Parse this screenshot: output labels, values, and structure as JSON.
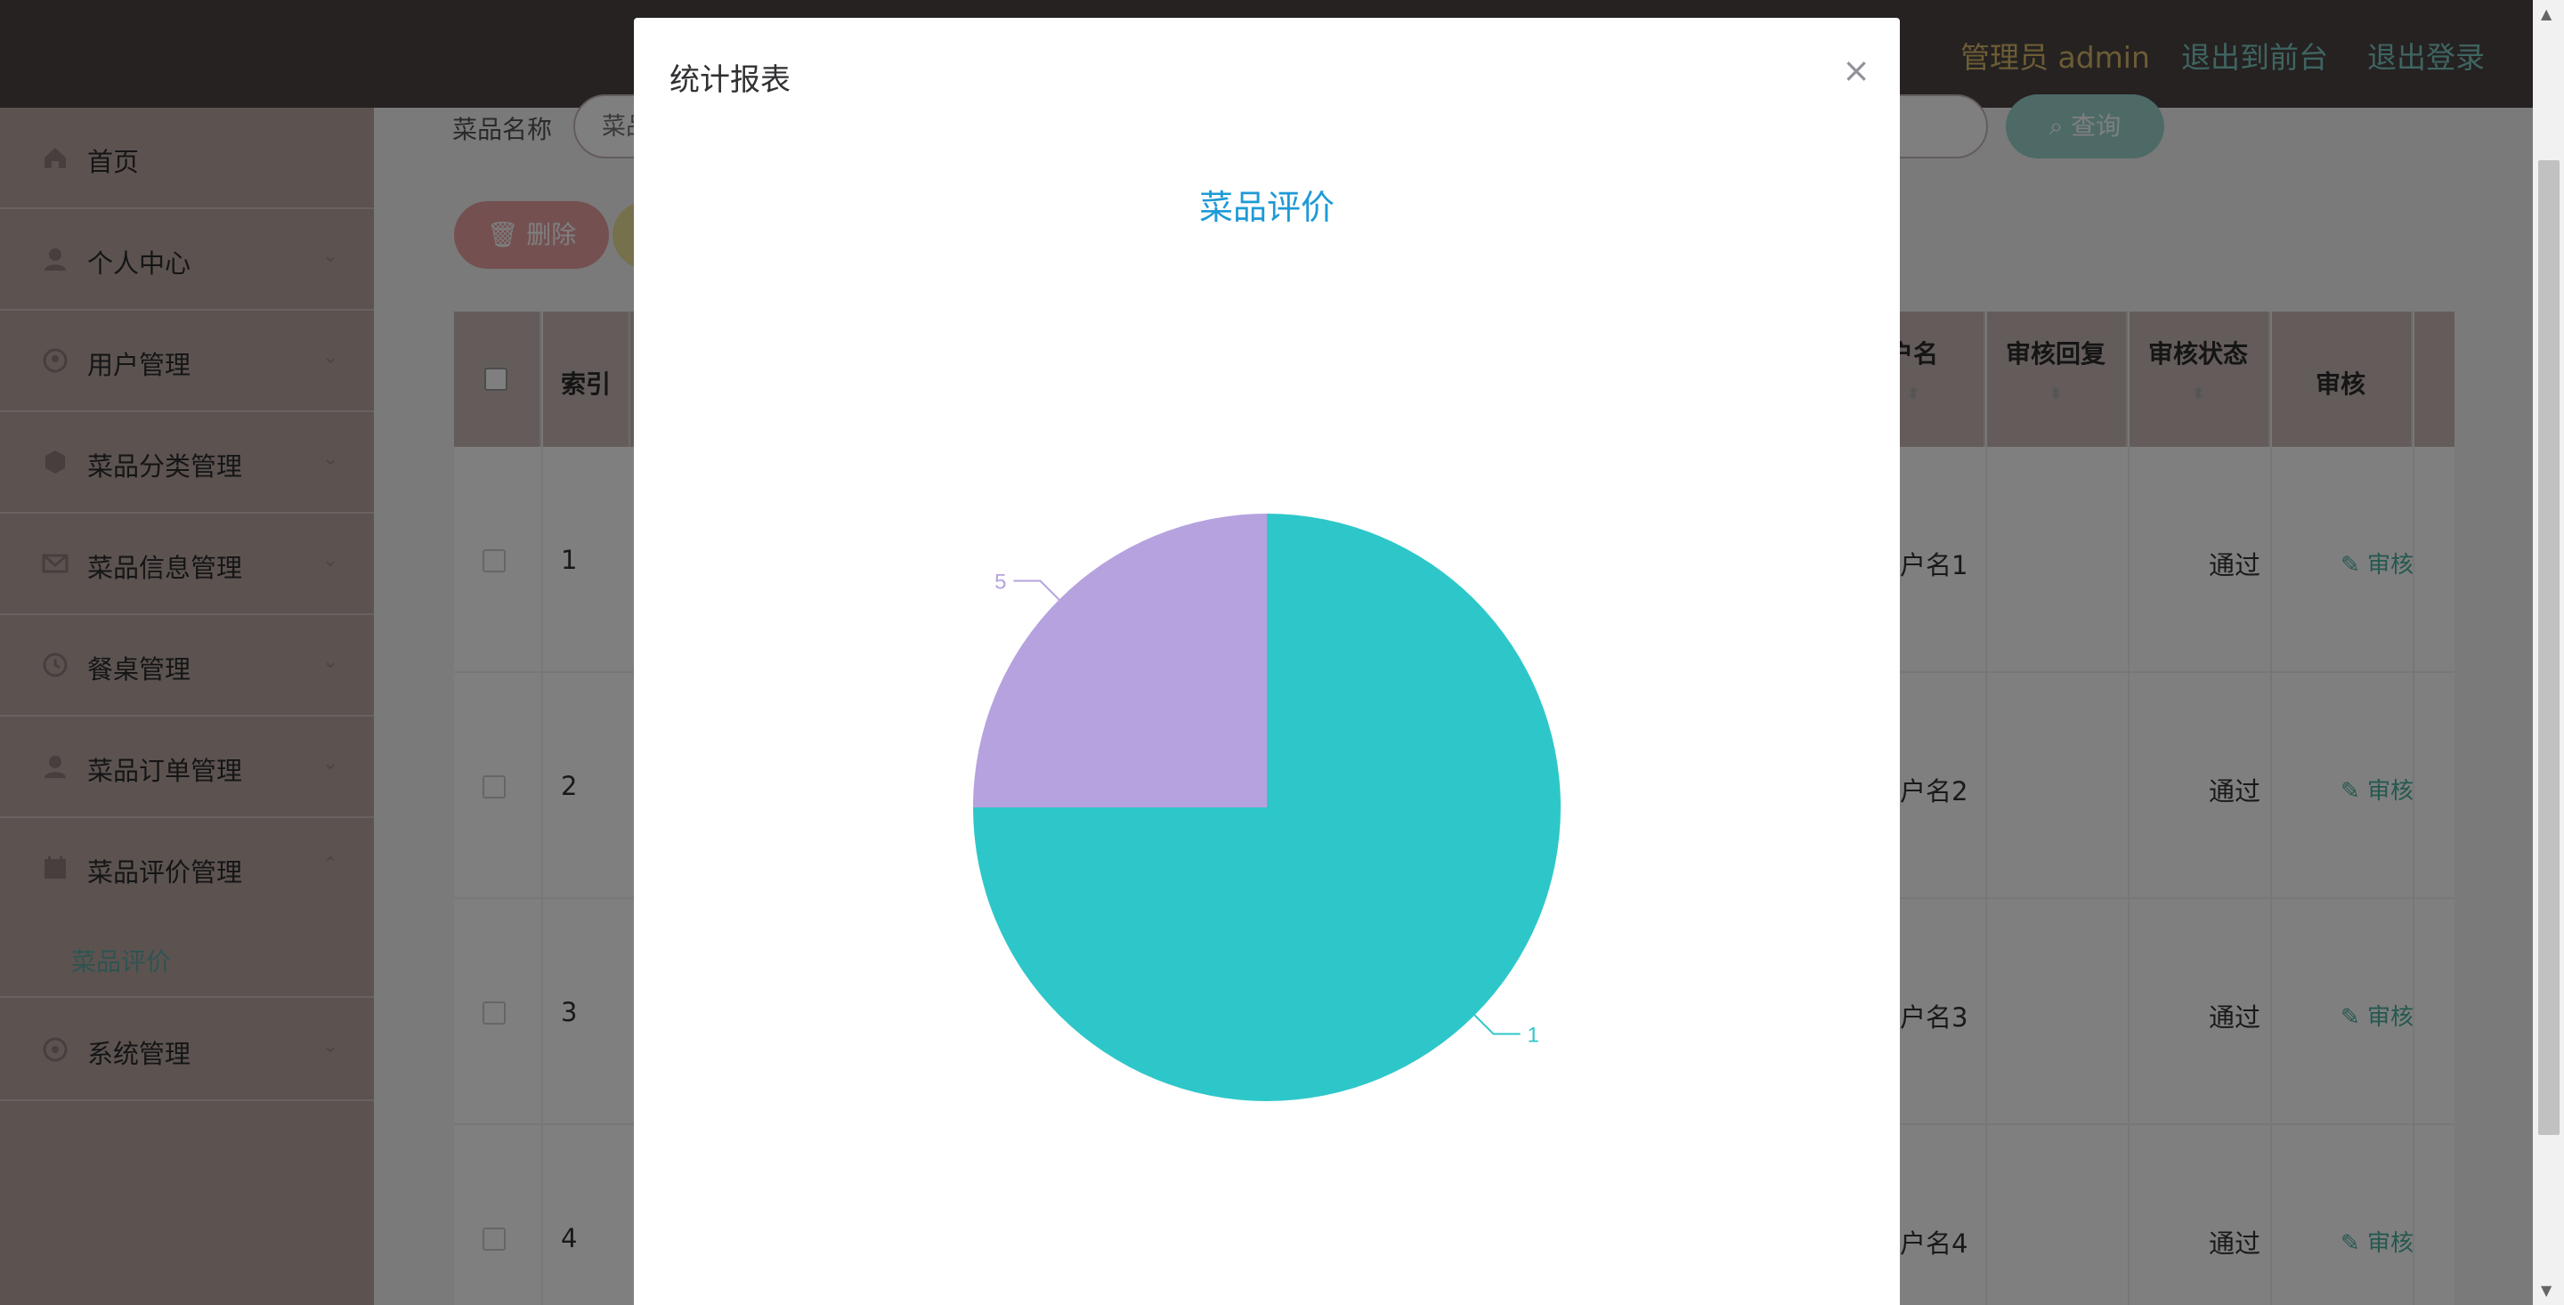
{
  "header": {
    "admin_label": "管理员 admin",
    "front_link": "退出到前台",
    "logout_link": "退出登录"
  },
  "sidebar": {
    "items": [
      {
        "label": "首页",
        "icon": "home-icon"
      },
      {
        "label": "个人中心",
        "icon": "user-icon"
      },
      {
        "label": "用户管理",
        "icon": "users-icon"
      },
      {
        "label": "菜品分类管理",
        "icon": "category-icon"
      },
      {
        "label": "菜品信息管理",
        "icon": "mail-icon"
      },
      {
        "label": "餐桌管理",
        "icon": "clock-icon"
      },
      {
        "label": "菜品订单管理",
        "icon": "order-icon"
      },
      {
        "label": "菜品评价管理",
        "icon": "comment-icon"
      }
    ],
    "active_sub": "菜品评价",
    "last_item": {
      "label": "系统管理",
      "icon": "settings-icon"
    }
  },
  "search": {
    "label": "菜品名称",
    "placeholder": "菜品",
    "button": "查询"
  },
  "toolbar": {
    "delete_label": "删除"
  },
  "table": {
    "headers": {
      "index": "索引",
      "username": "户名",
      "reply": "审核回复",
      "status": "审核状态",
      "audit": "审核"
    },
    "rows": [
      {
        "index": "1",
        "username": "户名1",
        "status": "通过",
        "audit": "审核"
      },
      {
        "index": "2",
        "username": "户名2",
        "status": "通过",
        "audit": "审核"
      },
      {
        "index": "3",
        "username": "户名3",
        "status": "通过",
        "audit": "审核"
      },
      {
        "index": "4",
        "username": "户名4",
        "status": "通过",
        "audit": "审核"
      }
    ]
  },
  "modal": {
    "title": "统计报表",
    "close_icon": "close-icon"
  },
  "colors": {
    "slice_teal": "#2ec7c9",
    "slice_purple": "#b6a2de",
    "chart_title": "#1e9ad6"
  },
  "chart_data": {
    "type": "pie",
    "title": "菜品评价",
    "slices": [
      {
        "label": "1",
        "value": 3,
        "color": "#2ec7c9"
      },
      {
        "label": "5",
        "value": 1,
        "color": "#b6a2de"
      }
    ],
    "legend": "none"
  }
}
